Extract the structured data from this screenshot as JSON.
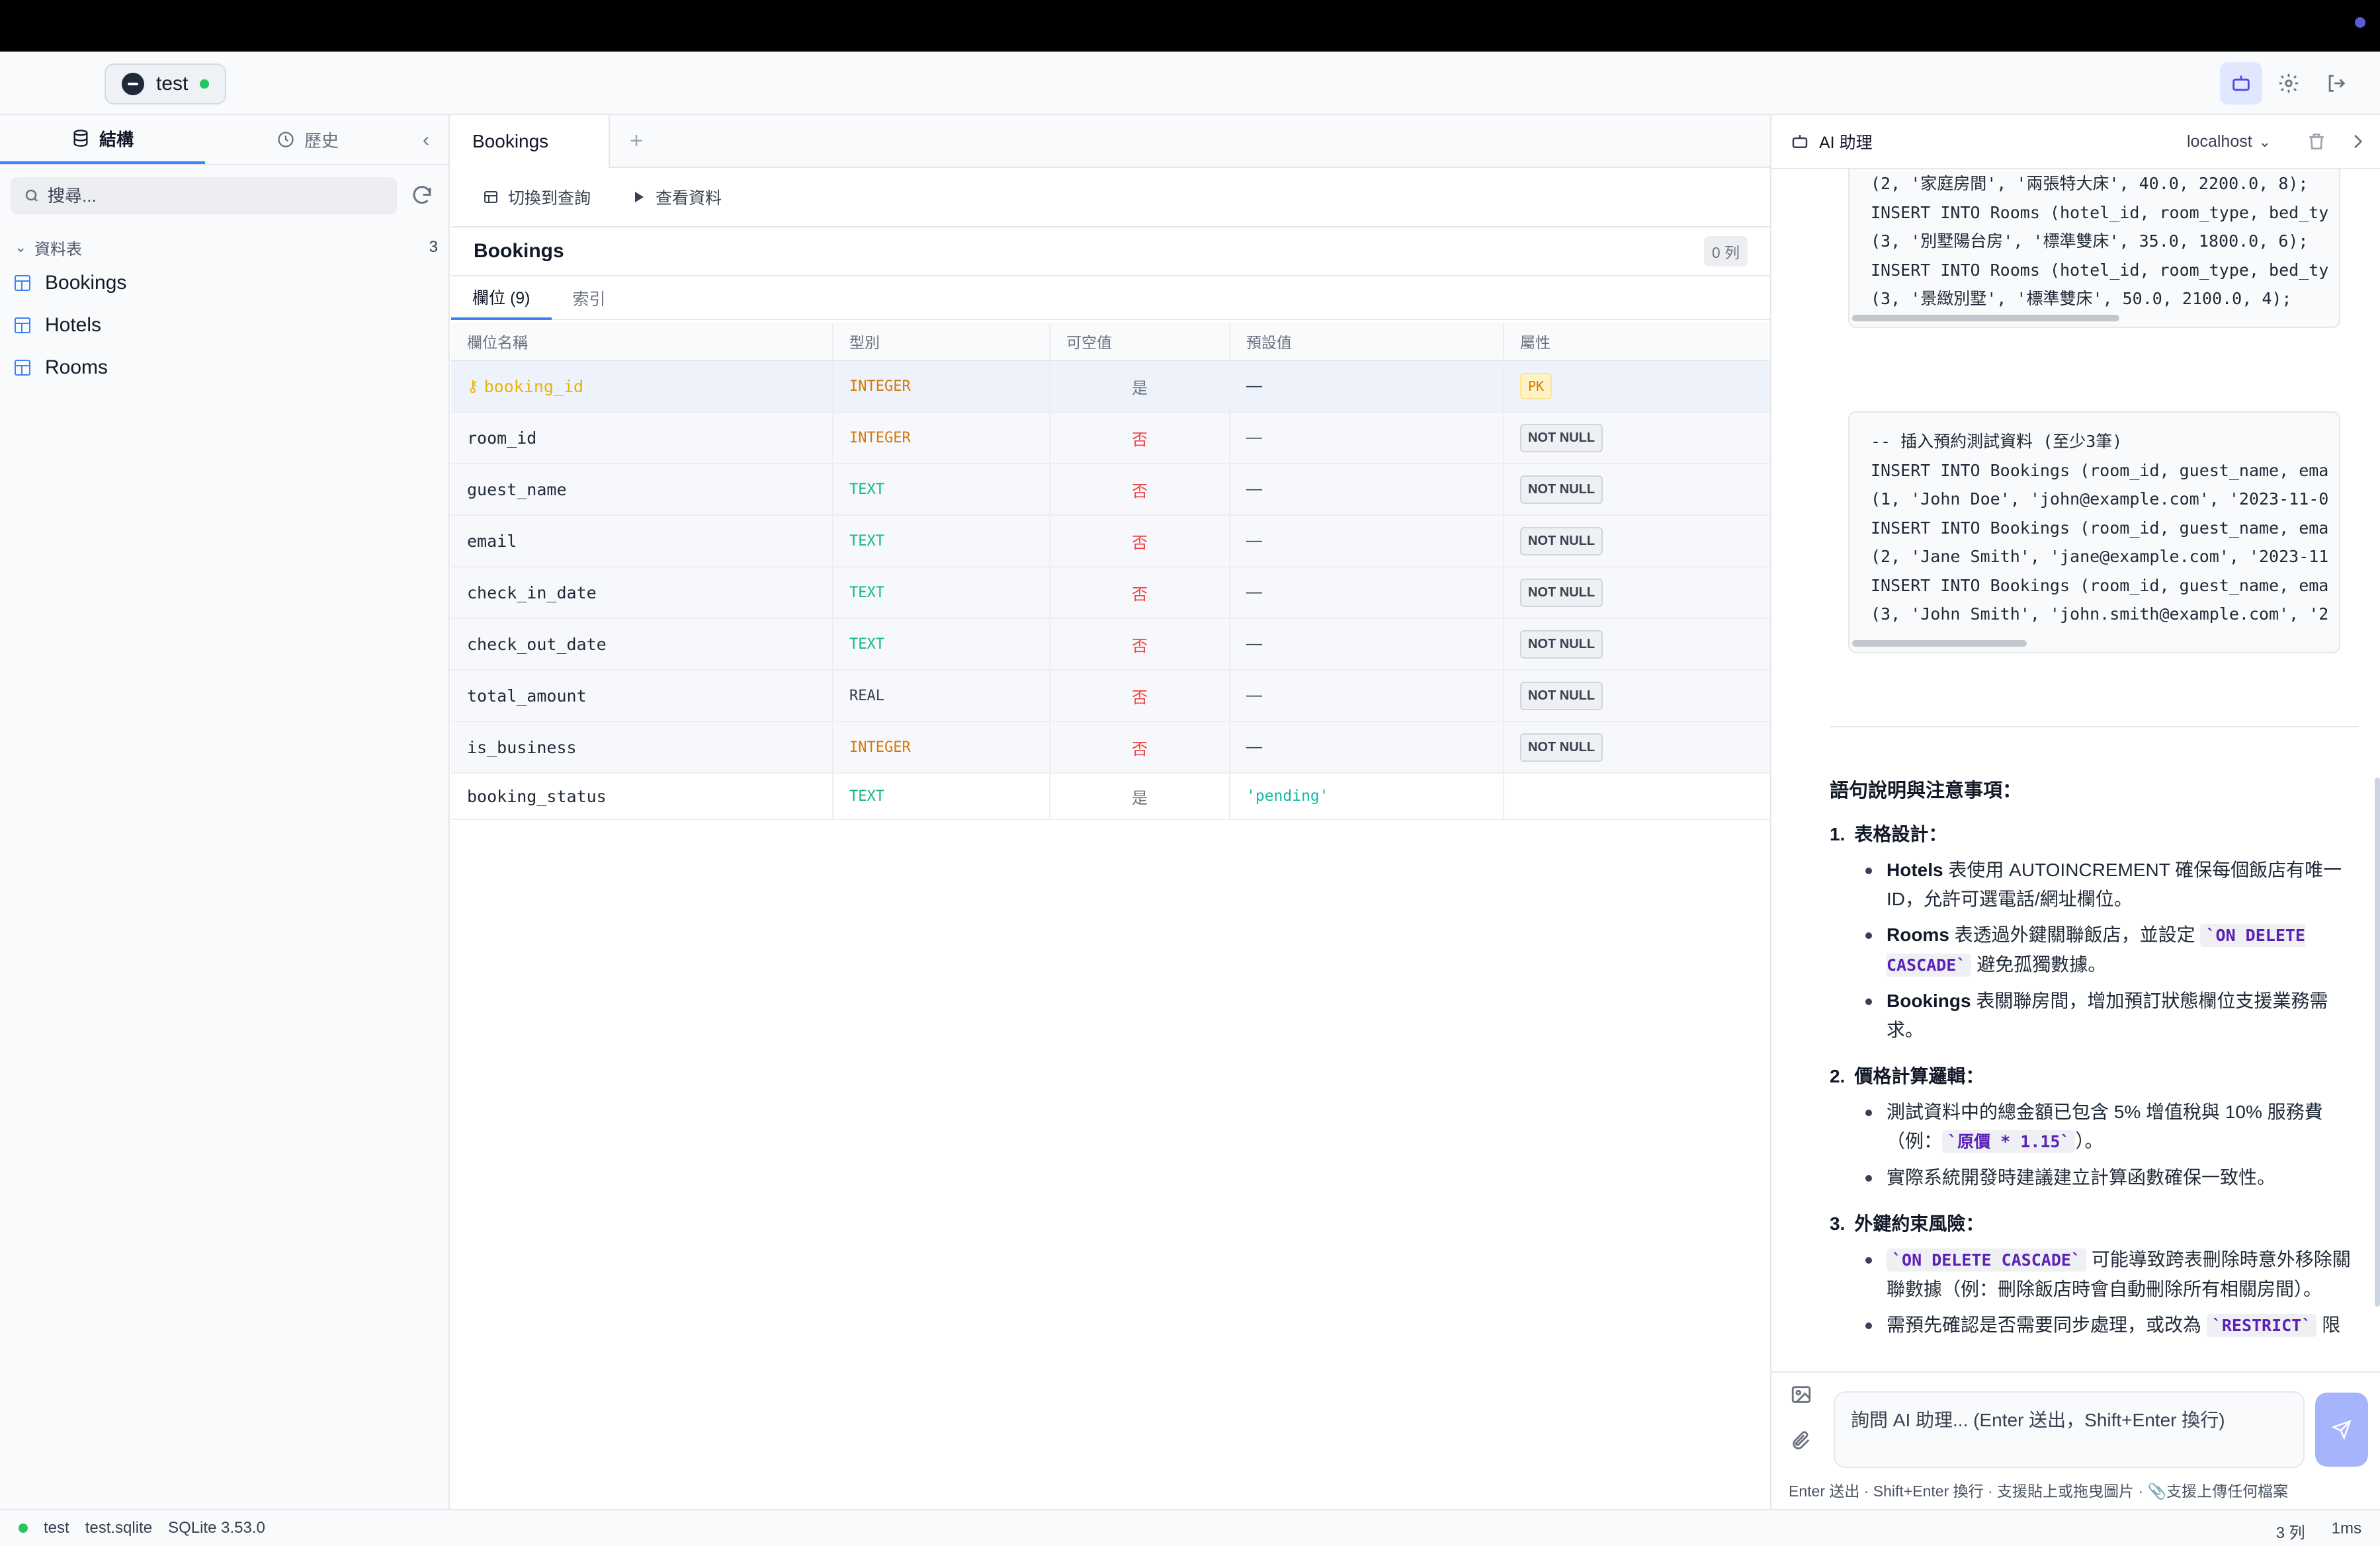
{
  "connection": {
    "name": "test"
  },
  "sidebar": {
    "tab_structure": "結構",
    "tab_history": "歷史",
    "search_placeholder": "搜尋...",
    "tables_header": "資料表",
    "tables_count": "3",
    "tables": [
      "Bookings",
      "Hotels",
      "Rooms"
    ]
  },
  "center": {
    "active_tab": "Bookings",
    "toolbar": {
      "switch_query": "切換到查詢",
      "view_data": "查看資料"
    },
    "table_title": "Bookings",
    "row_count": "0 列",
    "subtabs": {
      "columns": "欄位 (9)",
      "indexes": "索引"
    },
    "grid_headers": [
      "欄位名稱",
      "型別",
      "可空值",
      "預設值",
      "屬性"
    ],
    "rows": [
      {
        "name": "booking_id",
        "type": "INTEGER",
        "nullable": "是",
        "default": "—",
        "attr": "PK"
      },
      {
        "name": "room_id",
        "type": "INTEGER",
        "nullable": "否",
        "default": "—",
        "attr": "NOT NULL"
      },
      {
        "name": "guest_name",
        "type": "TEXT",
        "nullable": "否",
        "default": "—",
        "attr": "NOT NULL"
      },
      {
        "name": "email",
        "type": "TEXT",
        "nullable": "否",
        "default": "—",
        "attr": "NOT NULL"
      },
      {
        "name": "check_in_date",
        "type": "TEXT",
        "nullable": "否",
        "default": "—",
        "attr": "NOT NULL"
      },
      {
        "name": "check_out_date",
        "type": "TEXT",
        "nullable": "否",
        "default": "—",
        "attr": "NOT NULL"
      },
      {
        "name": "total_amount",
        "type": "REAL",
        "nullable": "否",
        "default": "—",
        "attr": "NOT NULL"
      },
      {
        "name": "is_business",
        "type": "INTEGER",
        "nullable": "否",
        "default": "—",
        "attr": "NOT NULL"
      },
      {
        "name": "booking_status",
        "type": "TEXT",
        "nullable": "是",
        "default": "'pending'",
        "attr": ""
      }
    ]
  },
  "ai": {
    "title": "AI 助理",
    "host": "localhost",
    "code1": [
      "(2, '家庭房間', '兩張特大床', 40.0, 2200.0, 8);",
      "INSERT INTO Rooms (hotel_id, room_type, bed_ty",
      "(3, '別墅陽台房', '標準雙床', 35.0, 1800.0, 6);",
      "INSERT INTO Rooms (hotel_id, room_type, bed_ty",
      "(3, '景緻別墅', '標準雙床', 50.0, 2100.0, 4);"
    ],
    "code2": [
      "-- 插入預約測試資料 (至少3筆)",
      "INSERT INTO Bookings (room_id, guest_name, ema",
      "(1, 'John Doe', 'john@example.com', '2023-11-0",
      "INSERT INTO Bookings (room_id, guest_name, ema",
      "(2, 'Jane Smith', 'jane@example.com', '2023-11",
      "INSERT INTO Bookings (room_id, guest_name, ema",
      "(3, 'John Smith', 'john.smith@example.com', '2"
    ],
    "notes_title": "語句說明與注意事項：",
    "s1_num": "1.",
    "s1_title": "表格設計：",
    "s1_b1_bold": "Hotels",
    "s1_b1_text": " 表使用 AUTOINCREMENT 確保每個飯店有唯一ID，允許可選電話/網址欄位。",
    "s1_b2_bold": "Rooms",
    "s1_b2_text": " 表透過外鍵關聯飯店，並設定 ",
    "s1_b2_code": "`ON DELETE CASCADE`",
    "s1_b2_text2": " 避免孤獨數據。",
    "s1_b3_bold": "Bookings",
    "s1_b3_text": " 表關聯房間，增加預訂狀態欄位支援業務需求。",
    "s2_num": "2.",
    "s2_title": "價格計算邏輯：",
    "s2_b1_text": "測試資料中的總金額已包含 5% 增值稅與 10% 服務費（例：",
    "s2_b1_code": "`原價 * 1.15`",
    "s2_b1_text2": "）。",
    "s2_b2_text": "實際系統開發時建議建立計算函數確保一致性。",
    "s3_num": "3.",
    "s3_title": "外鍵約束風險：",
    "s3_b1_code": "`ON DELETE CASCADE`",
    "s3_b1_text": " 可能導致跨表刪除時意外移除關聯數據（例：刪除飯店時會自動刪除所有相關房間）。",
    "s3_b2_text": "需預先確認是否需要同步處理，或改為 ",
    "s3_b2_code": "`RESTRICT`",
    "s3_b2_text2": " 限",
    "input_placeholder": "詢問 AI 助理... (Enter 送出，Shift+Enter 換行)",
    "hint": "Enter 送出 · Shift+Enter 換行 · 支援貼上或拖曳圖片 · 📎支援上傳任何檔案"
  },
  "status": {
    "conn": "test",
    "file": "test.sqlite",
    "engine": "SQLite 3.53.0",
    "rows": "3 列",
    "time": "1ms"
  }
}
